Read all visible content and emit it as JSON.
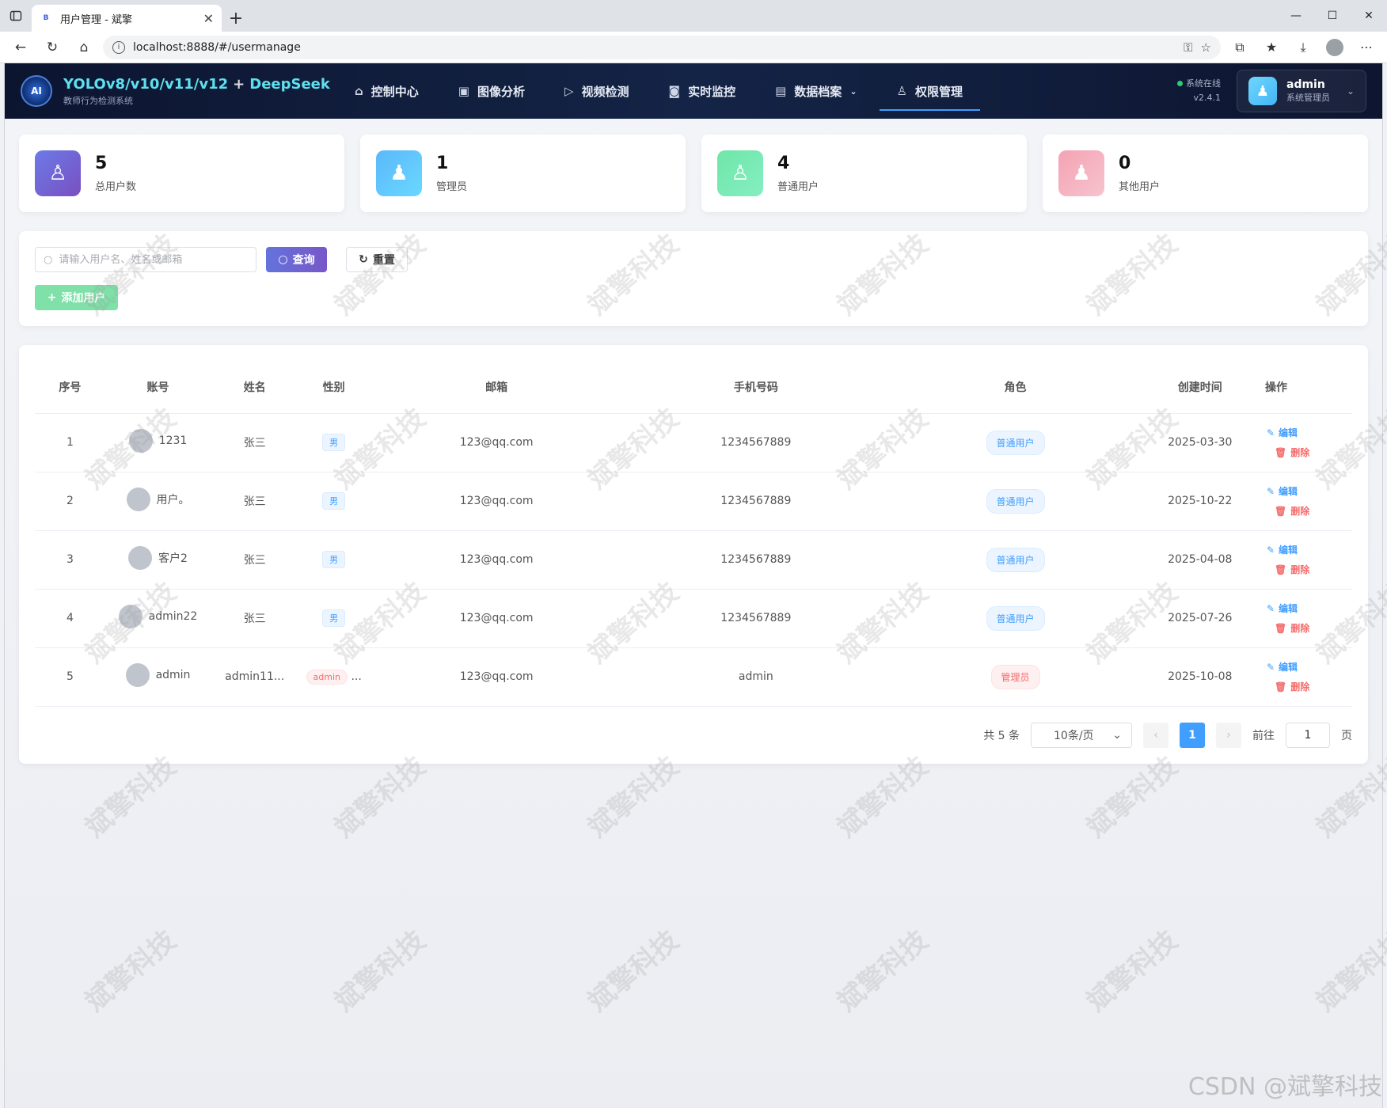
{
  "browser": {
    "tab_title": "用户管理 - 斌擎",
    "tab_favicon": "B",
    "url": "localhost:8888/#/usermanage"
  },
  "app": {
    "title_main": "YOLOv8/v10/v11/v12",
    "title_plus": "+",
    "title_ai": "DeepSeek",
    "subtitle": "教师行为检测系统",
    "logo_text": "AI"
  },
  "nav": [
    {
      "label": "控制中心",
      "icon": "home-icon"
    },
    {
      "label": "图像分析",
      "icon": "image-icon"
    },
    {
      "label": "视频检测",
      "icon": "play-icon"
    },
    {
      "label": "实时监控",
      "icon": "camera-icon"
    },
    {
      "label": "数据档案",
      "icon": "document-icon"
    },
    {
      "label": "权限管理",
      "icon": "user-icon",
      "active": true
    }
  ],
  "status": {
    "text": "系统在线",
    "version": "v2.4.1"
  },
  "user": {
    "name": "admin",
    "role": "系统管理员"
  },
  "stats": [
    {
      "value": "5",
      "label": "总用户数"
    },
    {
      "value": "1",
      "label": "管理员"
    },
    {
      "value": "4",
      "label": "普通用户"
    },
    {
      "value": "0",
      "label": "其他用户"
    }
  ],
  "search": {
    "placeholder": "请输入用户名、姓名或邮箱",
    "query_label": "查询",
    "reset_label": "重置",
    "add_label": "添加用户"
  },
  "table": {
    "headers": {
      "index": "序号",
      "account": "账号",
      "name": "姓名",
      "gender": "性别",
      "email": "邮箱",
      "phone": "手机号码",
      "role": "角色",
      "created": "创建时间",
      "ops": "操作"
    },
    "edit_label": "编辑",
    "delete_label": "删除",
    "rows": [
      {
        "index": "1",
        "account": "1231",
        "name": "张三",
        "gender": "男",
        "email": "123@qq.com",
        "phone": "1234567889",
        "role": "普通用户",
        "created": "2025-03-30"
      },
      {
        "index": "2",
        "account": "用户。",
        "name": "张三",
        "gender": "男",
        "email": "123@qq.com",
        "phone": "1234567889",
        "role": "普通用户",
        "created": "2025-10-22"
      },
      {
        "index": "3",
        "account": "客户2",
        "name": "张三",
        "gender": "男",
        "email": "123@qq.com",
        "phone": "1234567889",
        "role": "普通用户",
        "created": "2025-04-08"
      },
      {
        "index": "4",
        "account": "admin22",
        "name": "张三",
        "gender": "男",
        "email": "123@qq.com",
        "phone": "1234567889",
        "role": "普通用户",
        "created": "2025-07-26"
      },
      {
        "index": "5",
        "account": "admin",
        "name": "admin11...",
        "gender": "admin",
        "gender_suffix": "...",
        "email": "123@qq.com",
        "phone": "admin",
        "role": "管理员",
        "created": "2025-10-08"
      }
    ]
  },
  "pager": {
    "total": "共 5 条",
    "page_size": "10条/页",
    "current": "1",
    "goto_prefix": "前往",
    "goto_value": "1",
    "goto_suffix": "页"
  },
  "watermark": {
    "text": "斌擎科技",
    "footer": "CSDN @斌擎科技"
  }
}
